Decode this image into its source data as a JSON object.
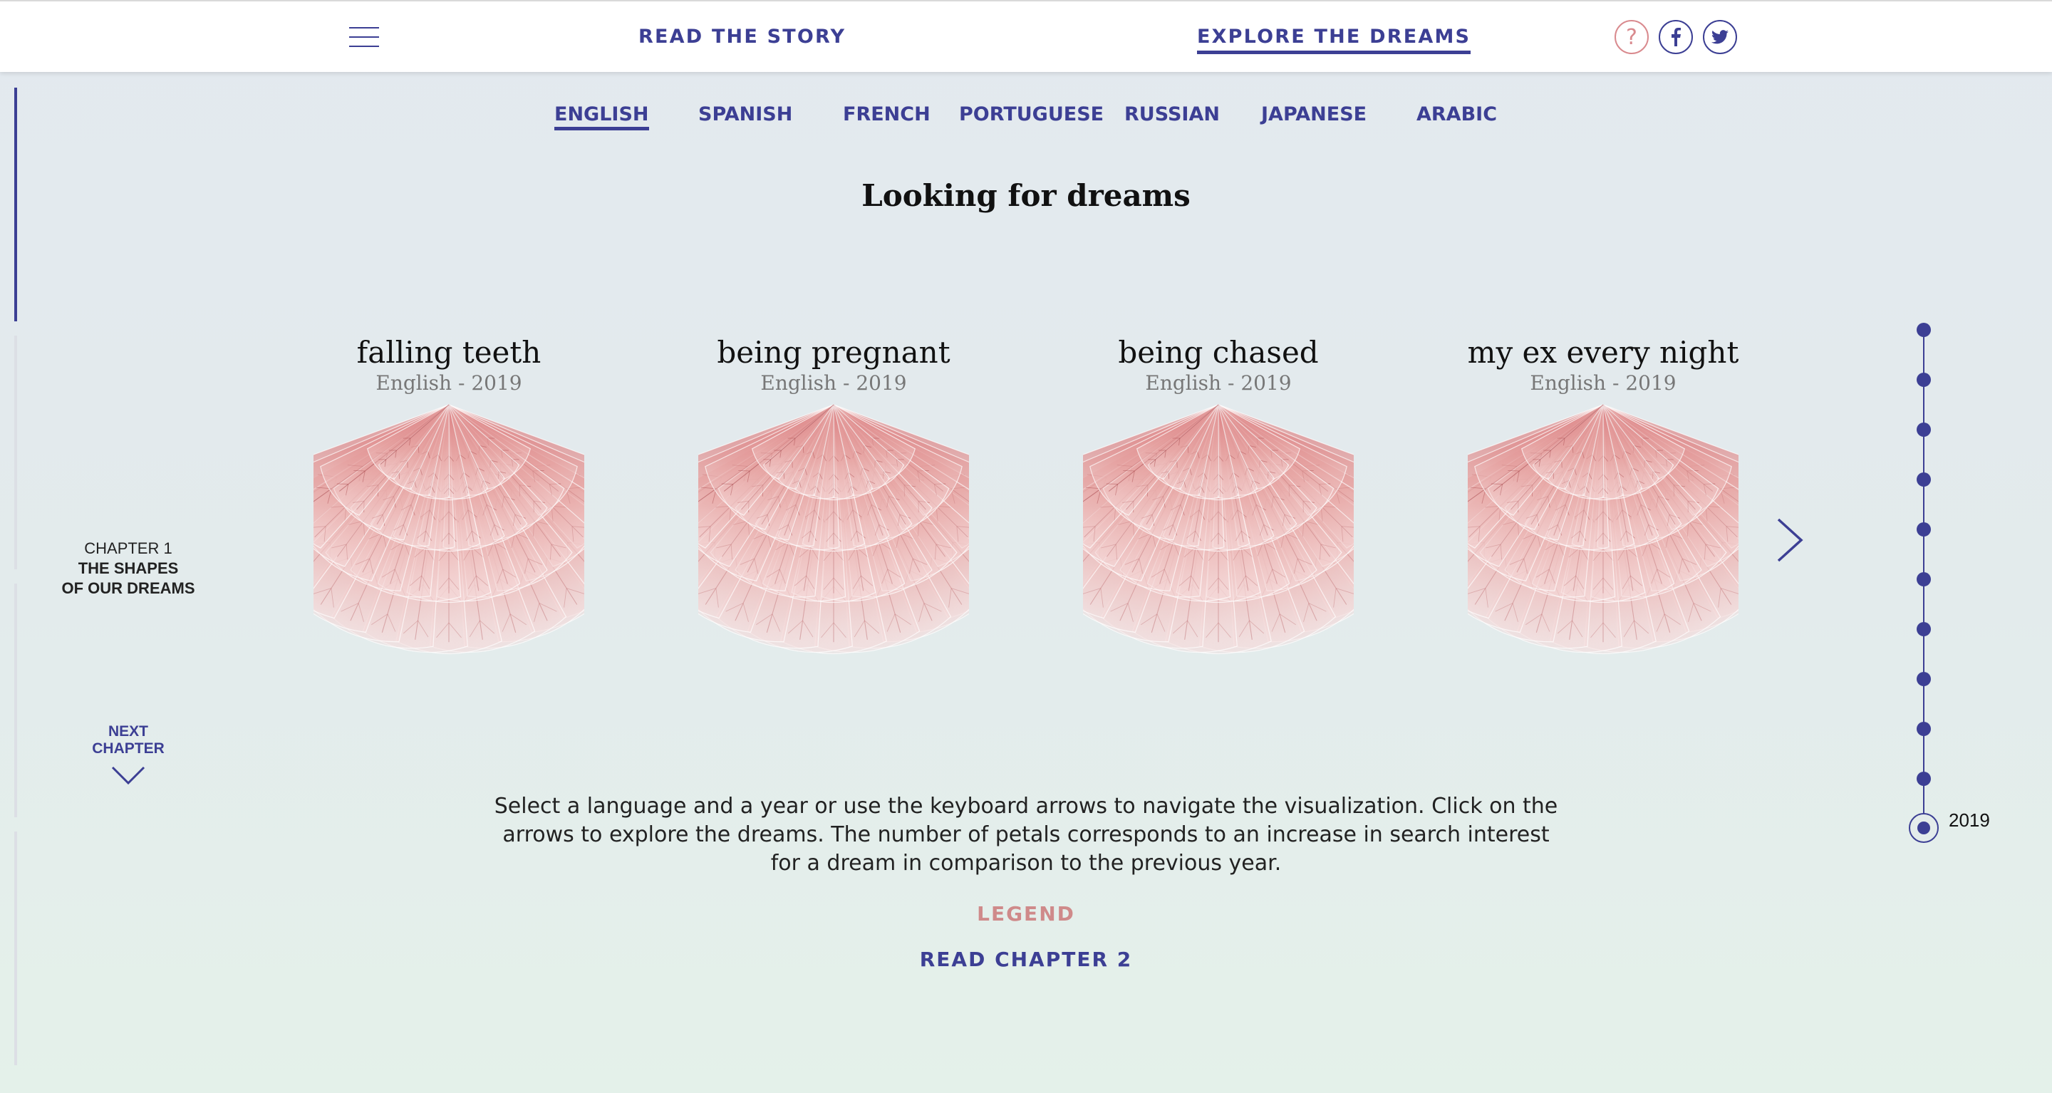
{
  "nav": {
    "read_story": "READ THE STORY",
    "explore_dreams": "EXPLORE THE DREAMS",
    "help_symbol": "?",
    "icons": [
      "menu-icon",
      "help-icon",
      "facebook-icon",
      "twitter-icon"
    ]
  },
  "languages": [
    "ENGLISH",
    "SPANISH",
    "FRENCH",
    "PORTUGUESE",
    "RUSSIAN",
    "JAPANESE",
    "ARABIC"
  ],
  "active_language": "ENGLISH",
  "title": "Looking for dreams",
  "chapter": {
    "number": "CHAPTER 1",
    "name_line1": "THE SHAPES",
    "name_line2": "OF OUR DREAMS",
    "next_line1": "NEXT",
    "next_line2": "CHAPTER"
  },
  "dreams": [
    {
      "title": "falling teeth",
      "subtitle": "English - 2019"
    },
    {
      "title": "being pregnant",
      "subtitle": "English - 2019"
    },
    {
      "title": "being chased",
      "subtitle": "English - 2019"
    },
    {
      "title": "my ex every night",
      "subtitle": "English - 2019"
    }
  ],
  "timeline": {
    "selected_year": "2019",
    "steps": 11
  },
  "description": "Select a language and a year or use the keyboard arrows to navigate the visualization. Click on the arrows to explore the dreams. The number of petals corresponds to an increase in search interest for a dream in comparison to the previous year.",
  "legend_label": "LEGEND",
  "read_chapter_label": "READ CHAPTER 2",
  "colors": {
    "accent": "#3c3f94",
    "petal": "#e8aaa8",
    "vein": "#a8474c",
    "legend": "#cf8a8a"
  }
}
